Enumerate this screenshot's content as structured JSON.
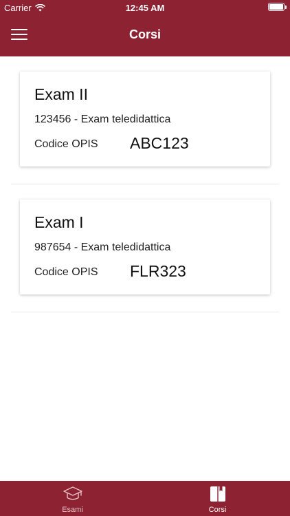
{
  "status_bar": {
    "carrier": "Carrier",
    "time": "12:45 AM"
  },
  "header": {
    "title": "Corsi",
    "menu_icon": "hamburger-menu-icon"
  },
  "courses": [
    {
      "title": "Exam II",
      "subtitle": "123456 - Exam teledidattica",
      "opis_label": "Codice OPIS",
      "opis_code": "ABC123"
    },
    {
      "title": "Exam I",
      "subtitle": "987654 - Exam teledidattica",
      "opis_label": "Codice OPIS",
      "opis_code": "FLR323"
    }
  ],
  "tabbar": {
    "tabs": [
      {
        "label": "Esami",
        "icon": "graduation-cap-icon",
        "active": false
      },
      {
        "label": "Corsi",
        "icon": "book-icon",
        "active": true
      }
    ]
  },
  "colors": {
    "primary": "#8c2232",
    "background": "#ffffff",
    "tab_inactive": "#e9c2c7"
  }
}
